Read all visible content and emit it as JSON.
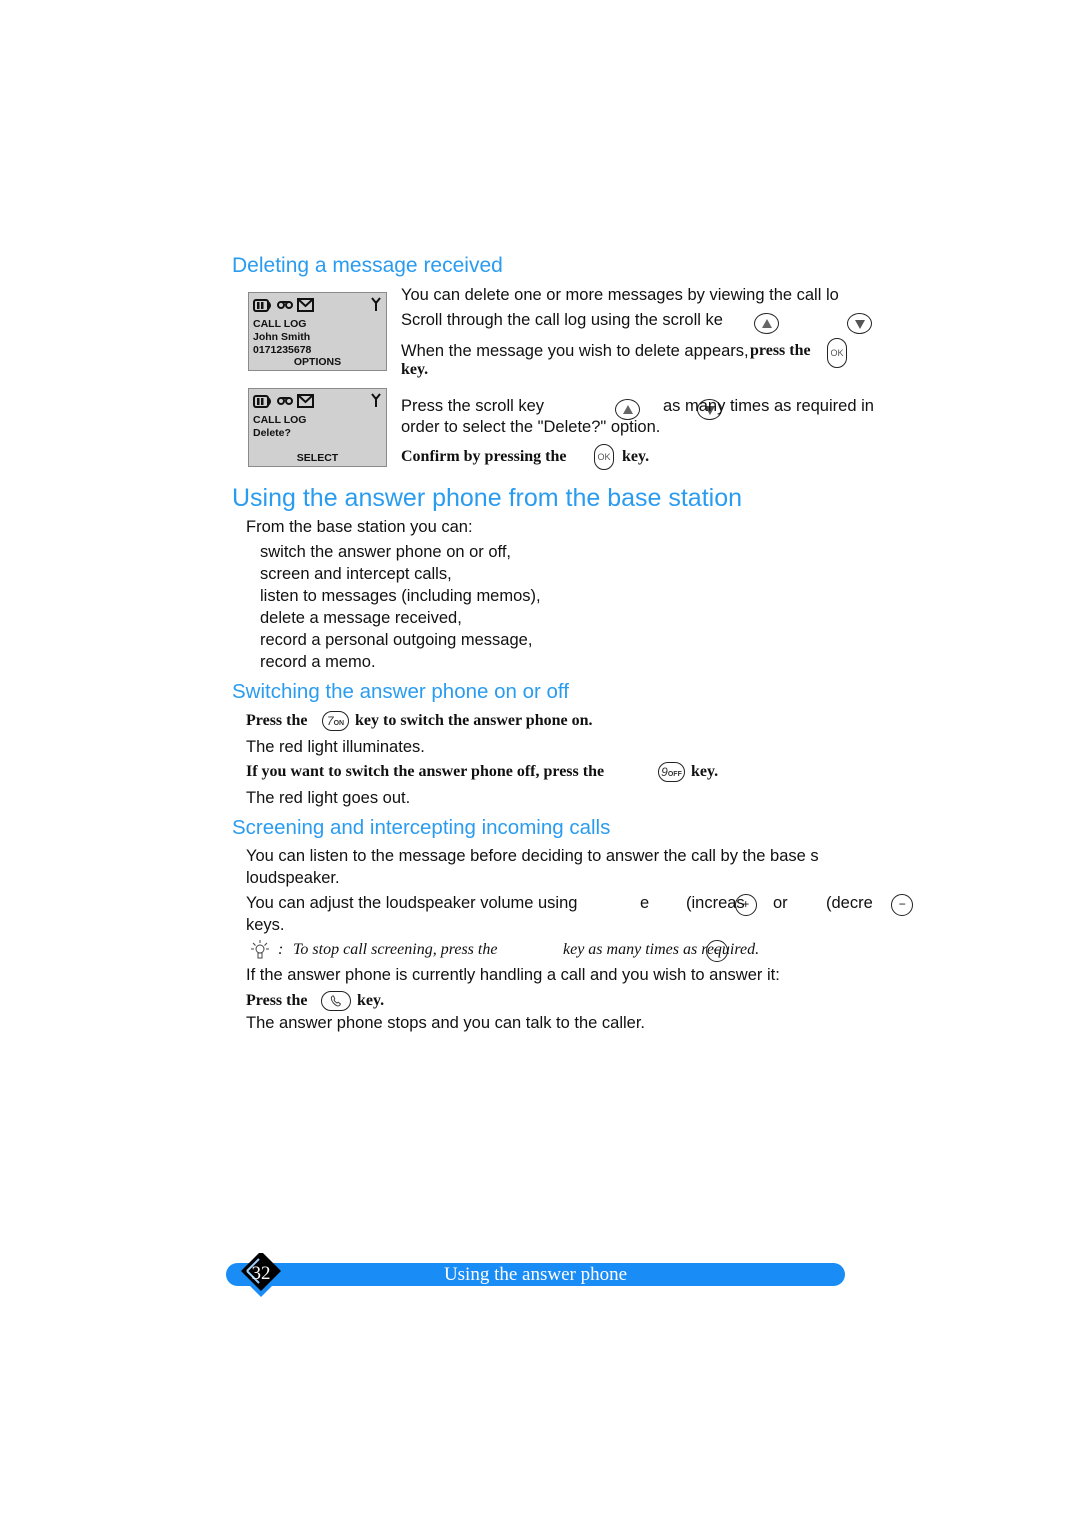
{
  "section_deleting": {
    "heading": "Deleting a message received",
    "lcd_screens": [
      {
        "lines": [
          "CALL LOG",
          "John Smith",
          "0171235678"
        ],
        "softkey": "OPTIONS",
        "icons": [
          "battery-icon",
          "tape-icon",
          "envelope-icon",
          "antenna-icon"
        ]
      },
      {
        "lines": [
          "CALL LOG",
          "Delete?"
        ],
        "softkey": "SELECT",
        "icons": [
          "battery-icon",
          "tape-icon",
          "envelope-icon",
          "antenna-icon"
        ]
      }
    ],
    "para1": "You can delete one or more messages by viewing the call lo",
    "para2": "Scroll through the call log using the scroll ke",
    "para3_text": "When the message you wish to delete appears,",
    "para3_bold": "press the",
    "para3_key": "OK",
    "para3_end": "key.",
    "para4_a": "Press the scroll key",
    "para4_b": "as many times as required in",
    "para4_c": "order to select the \"Delete?\" option.",
    "para5_bold": "Confirm by pressing the",
    "para5_key": "OK",
    "para5_end": "key."
  },
  "section_base": {
    "heading": "Using the answer phone from the base station",
    "intro": "From the base station you can:",
    "items": [
      "switch the answer phone on or off,",
      "screen and intercept calls,",
      "listen to messages (including memos),",
      "delete a message received,",
      "record a personal outgoing message,",
      "record a memo."
    ]
  },
  "section_switching": {
    "heading": "Switching the answer phone on or off",
    "step1_a": "Press the",
    "step1_key_num": "7",
    "step1_key_label": "ON",
    "step1_b": "key to switch the answer phone on.",
    "result1": "The red light illuminates.",
    "step2_a": "If you want to switch the answer phone off, press the",
    "step2_key_num": "9",
    "step2_key_label": "OFF",
    "step2_b": "key.",
    "result2": "The red light goes out."
  },
  "section_screening": {
    "heading": "Screening and intercepting incoming calls",
    "para1": "You can listen to the message before deciding to answer the call by the base s",
    "para1_cont": "loudspeaker.",
    "para2_a": "You can adjust the loudspeaker volume using",
    "para2_plus": "+",
    "para2_b": "e",
    "para2_c": "(increas",
    "para2_minus": "−",
    "para2_d": "or",
    "para2_e": "(decre",
    "para2_cont": "keys.",
    "tip_sep": ":",
    "tip_a": "To stop call screening, press the",
    "tip_key": "−",
    "tip_b": "key as many times as required.",
    "para3": "If the answer phone is currently handling a call and you wish to answer it:",
    "step_a": "Press the",
    "step_b": "key.",
    "result": "The answer phone stops and you can talk to the caller."
  },
  "footer": {
    "page_number": "32",
    "title": "Using the answer phone",
    "bar_color": "#1a8cf5"
  },
  "colors": {
    "heading": "#2a9cf0",
    "lcd_bg": "#d0d0d0"
  }
}
